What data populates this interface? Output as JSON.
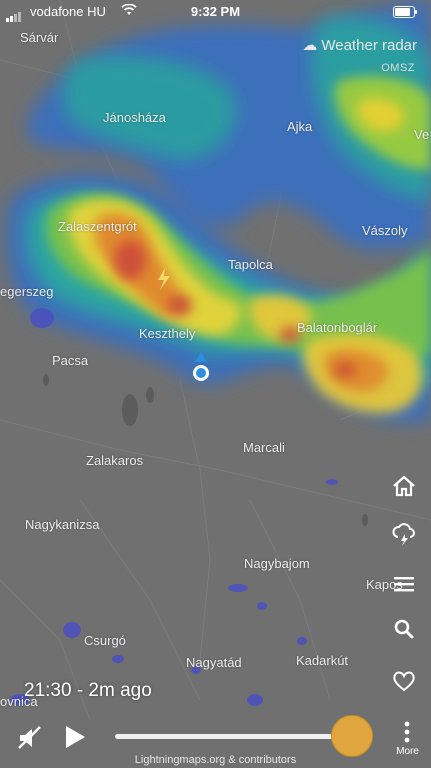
{
  "status_bar": {
    "carrier": "vodafone HU",
    "time": "9:32 PM"
  },
  "radar": {
    "title": "Weather radar",
    "source": "OMSZ"
  },
  "cities": [
    {
      "id": "sarvar",
      "name": "Sárvár"
    },
    {
      "id": "janoshaza",
      "name": "Jánosháza"
    },
    {
      "id": "ajka",
      "name": "Ajka"
    },
    {
      "id": "ve",
      "name": "Ve"
    },
    {
      "id": "zalaszentgrot",
      "name": "Zalaszentgrót"
    },
    {
      "id": "vaszoly",
      "name": "Vászoly"
    },
    {
      "id": "tapolca",
      "name": "Tapolca"
    },
    {
      "id": "egerszeg",
      "name": "egerszeg"
    },
    {
      "id": "keszthely",
      "name": "Keszthely"
    },
    {
      "id": "balatonboglar",
      "name": "Balatonboglár"
    },
    {
      "id": "pacsa",
      "name": "Pacsa"
    },
    {
      "id": "marcali",
      "name": "Marcali"
    },
    {
      "id": "zalakaros",
      "name": "Zalakaros"
    },
    {
      "id": "kaposvar",
      "name": "Kapos"
    },
    {
      "id": "nagykanizsa",
      "name": "Nagykanizsa"
    },
    {
      "id": "nagybajom",
      "name": "Nagybajom"
    },
    {
      "id": "csurgo",
      "name": "Csurgó"
    },
    {
      "id": "nagyatad",
      "name": "Nagyatád"
    },
    {
      "id": "kadarkut",
      "name": "Kadarkút"
    },
    {
      "id": "ovnica",
      "name": "ovnica"
    }
  ],
  "timeline": {
    "timestamp": "21:30 - 2m ago",
    "position": 0.92
  },
  "credit": "Lightningmaps.org & contributors",
  "side_menu": {
    "more_label": "More"
  },
  "colors": {
    "slider_knob": "#e0a53c",
    "location": "#2b8fe0"
  }
}
